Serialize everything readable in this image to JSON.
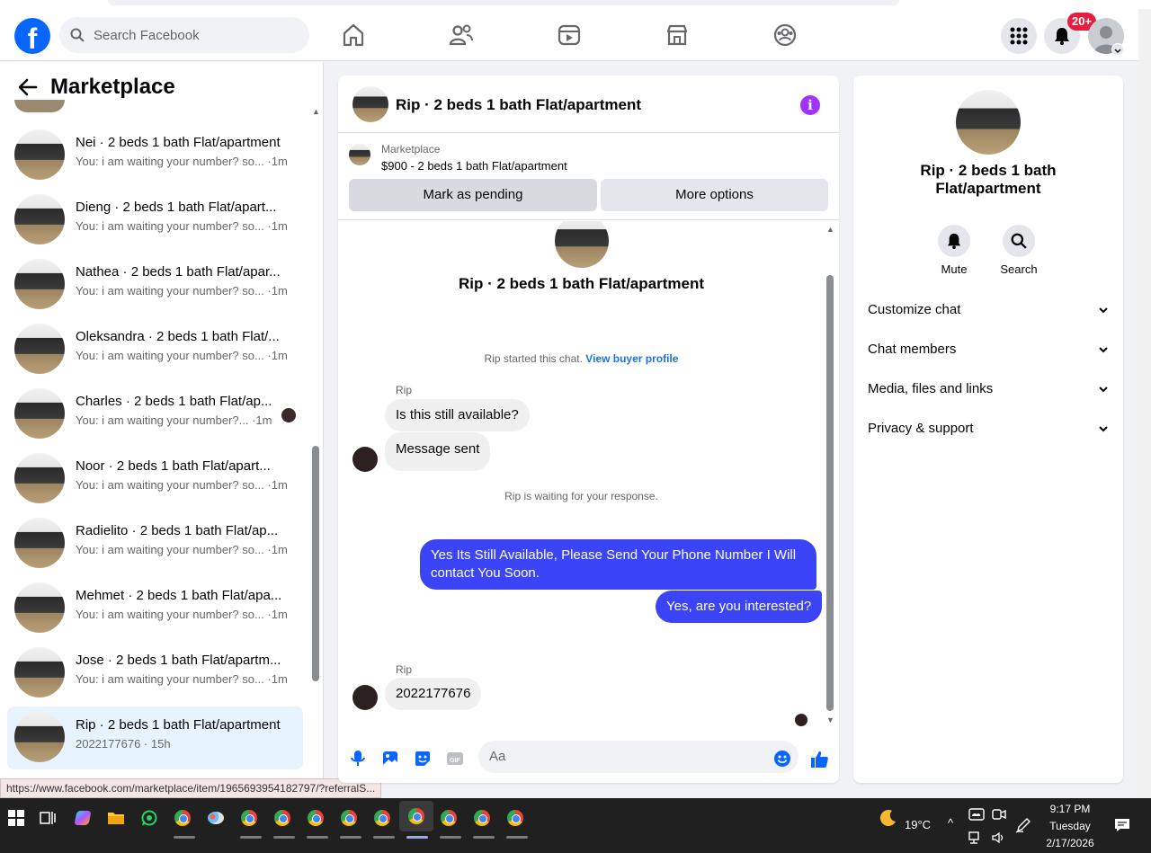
{
  "header": {
    "logo_letter": "f",
    "search_placeholder": "Search Facebook",
    "notifications_badge": "20+",
    "nav_icons": [
      "home-icon",
      "friends-icon",
      "video-icon",
      "marketplace-icon",
      "groups-icon"
    ]
  },
  "sidebar": {
    "title": "Marketplace",
    "conversations": [
      {
        "title": "Nei · 2 beds 1 bath Flat/apartment",
        "sub": "You: i am waiting your number? so... ·1m"
      },
      {
        "title": "Dieng · 2 beds 1 bath Flat/apart...",
        "sub": "You: i am waiting your number? so... ·1m"
      },
      {
        "title": "Nathea · 2 beds 1 bath Flat/apar...",
        "sub": "You: i am waiting your number? so... ·1m"
      },
      {
        "title": "Oleksandra · 2 beds 1 bath Flat/...",
        "sub": "You: i am waiting your number? so... ·1m"
      },
      {
        "title": "Charles · 2 beds 1 bath Flat/ap...",
        "sub": "You: i am waiting your number?... ·1m"
      },
      {
        "title": "Noor · 2 beds 1 bath Flat/apart...",
        "sub": "You: i am waiting your number? so... ·1m"
      },
      {
        "title": "Radielito · 2 beds 1 bath Flat/ap...",
        "sub": "You: i am waiting your number? so... ·1m"
      },
      {
        "title": "Mehmet · 2 beds 1 bath Flat/apa...",
        "sub": "You: i am waiting your number? so... ·1m"
      },
      {
        "title": "Jose · 2 beds 1 bath Flat/apartm...",
        "sub": "You: i am waiting your number? so... ·1m"
      },
      {
        "title": "Rip · 2 beds 1 bath Flat/apartment",
        "sub": "2022177676 · 15h"
      }
    ]
  },
  "status_url": "https://www.facebook.com/marketplace/item/1965693954182797/?referralS...",
  "chat": {
    "title": "Rip · 2 beds 1 bath Flat/apartment",
    "marketplace_label": "Marketplace",
    "listing": "$900 - 2 beds 1 bath Flat/apartment",
    "mark_pending": "Mark as pending",
    "more_options": "More options",
    "intro_name": "Rip · 2 beds 1 bath Flat/apartment",
    "started_text": "Rip started this chat.",
    "view_profile": "View buyer profile",
    "sender1": "Rip",
    "msg1": "Is this still available?",
    "msg2": "Message sent",
    "waiting": "Rip is waiting for your response.",
    "out1": "Yes Its Still Available, Please Send Your Phone Number I Will contact You Soon.",
    "out2": "Yes, are you interested?",
    "sender2": "Rip",
    "msg3": "2022177676",
    "composer_placeholder": "Aa"
  },
  "details": {
    "name": "Rip · 2 beds 1 bath Flat/apartment",
    "mute": "Mute",
    "search": "Search",
    "sections": [
      "Customize chat",
      "Chat members",
      "Media, files and links",
      "Privacy & support"
    ]
  },
  "taskbar": {
    "temp": "19°C",
    "time": "9:17 PM",
    "day": "Tuesday",
    "date": "2/17/2026"
  },
  "colors": {
    "brand": "#0866ff",
    "bubble_out": "#3b44f6",
    "selected_row": "#e7f3ff",
    "badge": "#e41e3f"
  }
}
